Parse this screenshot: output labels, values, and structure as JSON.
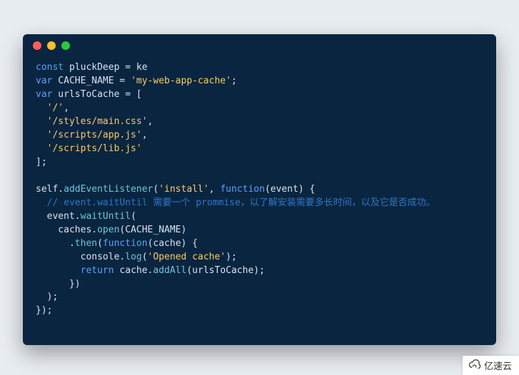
{
  "window": {
    "traffic_lights": [
      "close",
      "minimize",
      "zoom"
    ]
  },
  "code": {
    "line1_kw": "const",
    "line1_rest": " pluckDeep = ke",
    "line2_kw": "var",
    "line2_id": " CACHE_NAME = ",
    "line2_str": "'my-web-app-cache'",
    "line2_end": ";",
    "line3_kw": "var",
    "line3_rest": " urlsToCache = [",
    "arr0": "'/'",
    "arr0_comma": ",",
    "arr1": "'/styles/main.css'",
    "arr1_comma": ",",
    "arr2": "'/scripts/app.js'",
    "arr2_comma": ",",
    "arr3": "'/scripts/lib.js'",
    "arr_close": "];",
    "blank": "",
    "sel_self": "self.",
    "sel_add": "addEventListener",
    "sel_open": "(",
    "sel_evt": "'install'",
    "sel_mid": ", ",
    "sel_fnkw": "function",
    "sel_tail": "(event) {",
    "comment": "// event.waitUntil 需要一个 prommise，以了解安装需要多长时间，以及它是否成功。",
    "wu_line": "  event.",
    "wu_fn": "waitUntil",
    "wu_open": "(",
    "co_pre": "    caches.",
    "co_fn": "open",
    "co_args": "(CACHE_NAME)",
    "then_pre": "      .",
    "then_fn": "then",
    "then_open": "(",
    "then_fnkw": "function",
    "then_tail": "(cache) {",
    "log_pre": "        console.",
    "log_fn": "log",
    "log_open": "(",
    "log_str": "'Opened cache'",
    "log_close": ");",
    "ret_kw": "return",
    "ret_pre": " cache.",
    "ret_fn": "addAll",
    "ret_args": "(urlsToCache);",
    "close1": "      })",
    "close2": "  );",
    "close3": "});"
  },
  "watermark": {
    "text": "亿速云"
  }
}
